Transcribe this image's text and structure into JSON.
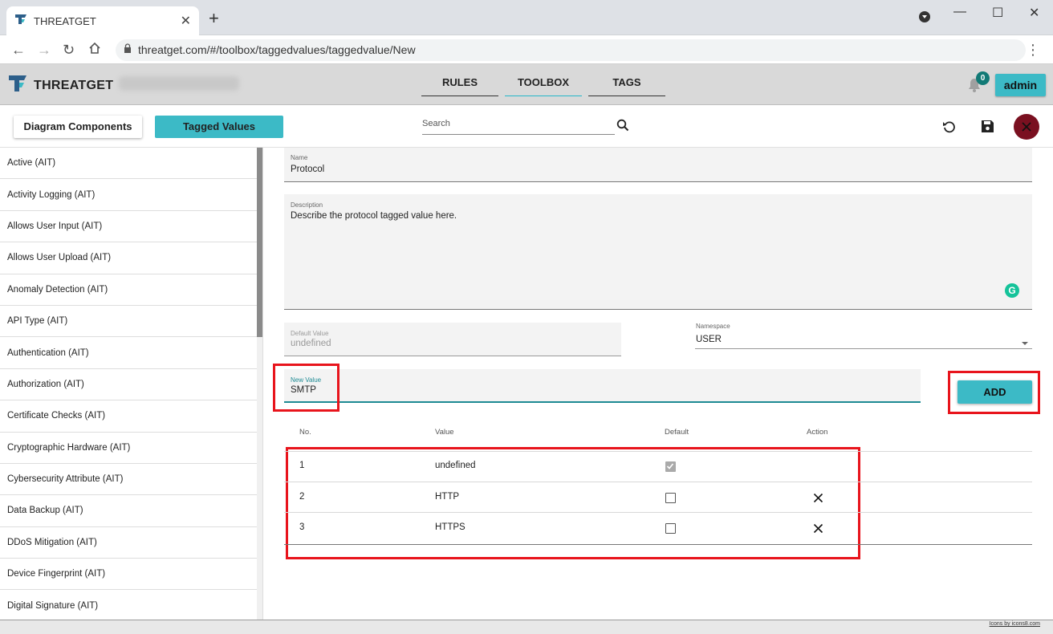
{
  "browser": {
    "tab_title": "THREATGET",
    "url": "threatget.com/#/toolbox/taggedvalues/taggedvalue/New"
  },
  "app": {
    "brand": "THREATGET",
    "nav": [
      "RULES",
      "TOOLBOX",
      "TAGS"
    ],
    "active_nav": "TOOLBOX",
    "notifications_count": "0",
    "user_button": "admin",
    "accent_color": "#3cbac6",
    "highlight_color": "#e8141c"
  },
  "toolbar": {
    "diagram_components": "Diagram Components",
    "tagged_values": "Tagged Values",
    "search_placeholder": "Search"
  },
  "sidebar": {
    "items": [
      "Active (AIT)",
      "Activity Logging (AIT)",
      "Allows User Input (AIT)",
      "Allows User Upload (AIT)",
      "Anomaly Detection (AIT)",
      "API Type (AIT)",
      "Authentication (AIT)",
      "Authorization (AIT)",
      "Certificate Checks (AIT)",
      "Cryptographic Hardware (AIT)",
      "Cybersecurity Attribute (AIT)",
      "Data Backup (AIT)",
      "DDoS Mitigation (AIT)",
      "Device Fingerprint (AIT)",
      "Digital Signature (AIT)"
    ]
  },
  "form": {
    "name_label": "Name",
    "name_value": "Protocol",
    "description_label": "Description",
    "description_value": "Describe the protocol tagged value here.",
    "default_label": "Default Value",
    "default_value": "undefined",
    "namespace_label": "Namespace",
    "namespace_value": "USER",
    "new_value_label": "New Value",
    "new_value": "SMTP",
    "add_button": "ADD"
  },
  "table": {
    "headers": [
      "No.",
      "Value",
      "Default",
      "Action"
    ],
    "rows": [
      {
        "no": "1",
        "value": "undefined",
        "default": true
      },
      {
        "no": "2",
        "value": "HTTP",
        "default": false
      },
      {
        "no": "3",
        "value": "HTTPS",
        "default": false
      }
    ]
  },
  "footer": {
    "credit": "Icons by icons8.com"
  }
}
